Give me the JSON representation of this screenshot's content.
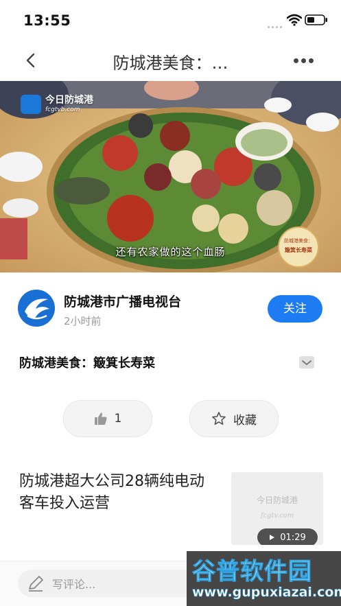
{
  "status_bar": {
    "time": "13:55"
  },
  "nav": {
    "title": "防城港美食：…"
  },
  "video": {
    "logo_text": "今日防城港",
    "logo_sub": "fcgtvb.com",
    "subtitle": "还有农家做的这个血肠",
    "stamp_top": "防城港美食：",
    "stamp_main": "簸箕长寿菜"
  },
  "publisher": {
    "name": "防城港市广播电视台",
    "time": "2小时前",
    "follow_label": "关注"
  },
  "article": {
    "title": "防城港美食：簸箕长寿菜"
  },
  "actions": {
    "like_count": "1",
    "favorite_label": "收藏"
  },
  "recommended": {
    "title": "防城港超大公司28辆纯电动客车投入运营",
    "thumb_logo": "今日防城港",
    "thumb_sub": "fcgtv.com",
    "duration": "01:29"
  },
  "comment": {
    "placeholder": "写评论..."
  },
  "watermark": {
    "main": "谷普软件园",
    "sub": "www.gupuxiazai.com"
  },
  "colors": {
    "accent": "#1e7cf2",
    "follow_text": "#ffffff"
  }
}
